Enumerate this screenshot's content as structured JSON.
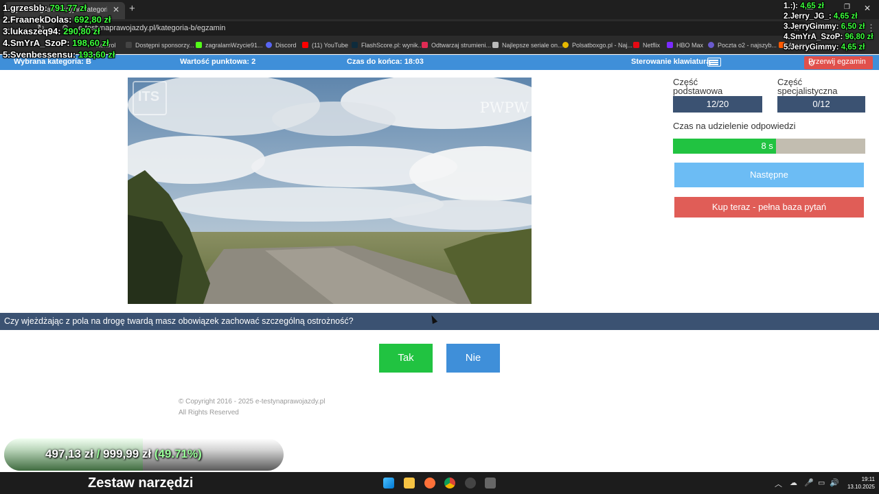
{
  "browser": {
    "tab_title": "Pytania egzaminacyjne kategorii B",
    "url": "e-testynaprawojazdy.pl/kategoria-b/egzamin",
    "bookmarks": [
      "Kontrol",
      "Dostępni sponsorzy...",
      "zagralamWzycie91...",
      "Discord",
      "(11) YouTube",
      "FlashScore.pl: wynik...",
      "Odtwarzaj strumieni...",
      "Najlepsze seriale on...",
      "Polsatboxgo.pl - Naj...",
      "Netflix",
      "HBO Max",
      "Poczta o2 - najszyb...",
      "Allegro"
    ]
  },
  "overlay": {
    "top_donors": [
      {
        "name": "1.grzesbb:",
        "amount": "791,77 zł"
      },
      {
        "name": "2.FraanekDolas:",
        "amount": "692,80 zł"
      },
      {
        "name": "3.lukaszeq94:",
        "amount": "290,80 zł"
      },
      {
        "name": "4.SmYrA_SzoP:",
        "amount": "198,60 zł"
      },
      {
        "name": "5.Svenbessensu:",
        "amount": "193,60 zł"
      }
    ],
    "recent_donors": [
      {
        "name": "1.:):",
        "amount": "4,65 zł"
      },
      {
        "name": "2.Jerry_JG_:",
        "amount": "4,65 zł"
      },
      {
        "name": "3.JerryGimmy:",
        "amount": "6,50 zł"
      },
      {
        "name": "4.SmYrA_SzoP:",
        "amount": "96,80 zł"
      },
      {
        "name": "5.JerryGimmy:",
        "amount": "4,65 zł"
      }
    ],
    "goal": {
      "current": "497,13 zł",
      "separator": "/",
      "target": "999,99 zł",
      "percent": "(49.71%)",
      "fraction": 0.4971
    },
    "toolbar_title": "Zestaw narzędzi"
  },
  "exam": {
    "category": "Wybrana kategoria: B",
    "points": "Wartość punktowa: 2",
    "time_left": "Czas do końca: 18:03",
    "keyboard_control": "Sterowanie klawiaturą",
    "abort": "Przerwij egzamin",
    "video_logo_left": "ITS",
    "video_logo_right": "PWPW",
    "part_basic_label": "Część podstawowa",
    "part_basic_value": "12/20",
    "part_special_label": "Część specjalistyczna",
    "part_special_value": "0/12",
    "answer_time_label": "Czas na udzielenie odpowiedzi",
    "answer_time_value": "8 s",
    "answer_time_fraction": 0.535,
    "next_button": "Następne",
    "buy_button": "Kup teraz - pełna baza pytań",
    "question": "Czy wjeżdżając z pola na drogę twardą masz obowiązek zachować szczególną ostrożność?",
    "answer_yes": "Tak",
    "answer_no": "Nie",
    "footer_copyright": "© Copyright 2016 - 2025 e-testynaprawojazdy.pl",
    "footer_rights": "All Rights Reserved"
  },
  "taskbar": {
    "time": "19:11",
    "date": "13.10.2025"
  },
  "colors": {
    "exam_header": "#3f8fd9",
    "navy": "#3b5272",
    "green": "#21c341",
    "danger": "#e05d57",
    "next": "#6cbcf4"
  }
}
